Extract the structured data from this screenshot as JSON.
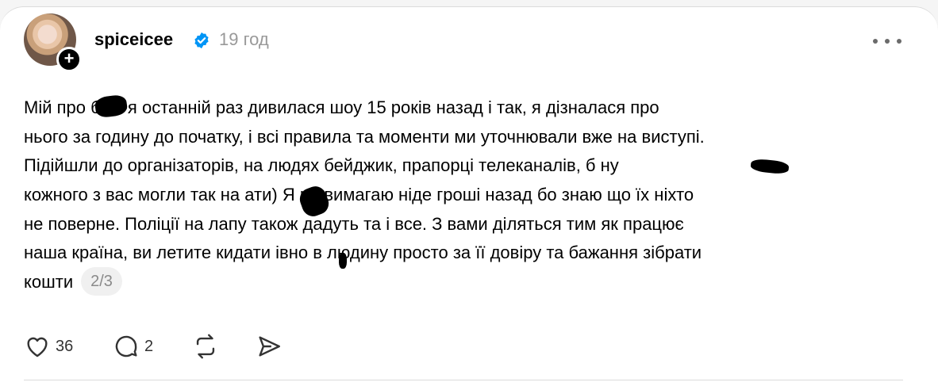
{
  "post": {
    "username": "spiceicee",
    "verified_icon": "verified-badge-icon",
    "time": "19 год",
    "more_icon": "more-options-icon",
    "lines": [
      "Мій про   б — я останній раз дивилася шоу 15 років назад і так, я дізналася про",
      "нього за годину до початку, і всі правила та моменти ми уточнювали вже на виступі.",
      "Підійшли до організаторів, на людях бейджик, прапорці телеканалів, б       ну",
      "кожного з вас могли так на    ати) Я не вимагаю ніде гроші назад бо знаю що їх ніхто",
      "не поверне. Поліції на лапу також дадуть та і все. З вами діляться тим як працює",
      "наша країна, ви летите кидати  івно в людину просто за її довіру та бажання зібрати",
      "кошти"
    ],
    "pager": "2/3"
  },
  "actions": {
    "like_count": "36",
    "reply_count": "2"
  },
  "colors": {
    "verified": "#0095f6",
    "muted": "#999999"
  }
}
